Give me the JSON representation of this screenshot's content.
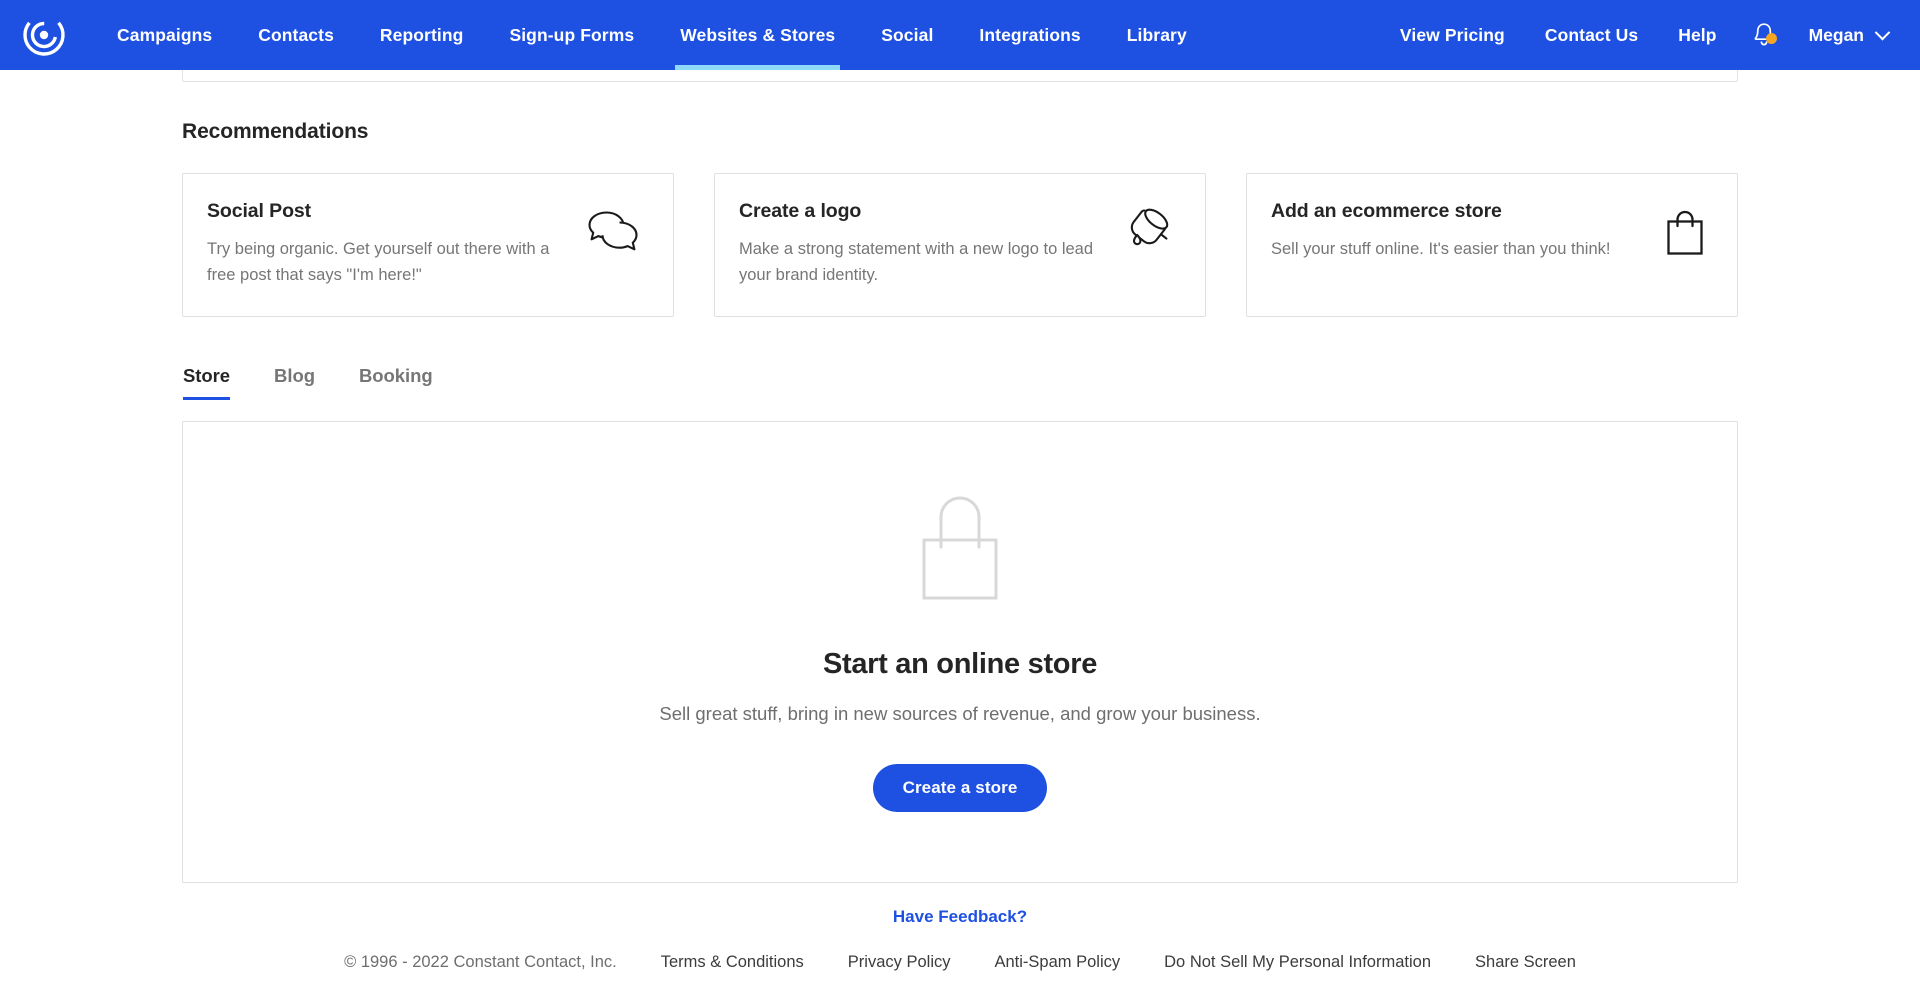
{
  "topnav": {
    "logo_icon": "constant-contact-logo-icon",
    "left_items": [
      {
        "label": "Campaigns",
        "active": false
      },
      {
        "label": "Contacts",
        "active": false
      },
      {
        "label": "Reporting",
        "active": false
      },
      {
        "label": "Sign-up Forms",
        "active": false
      },
      {
        "label": "Websites & Stores",
        "active": true
      },
      {
        "label": "Social",
        "active": false
      },
      {
        "label": "Integrations",
        "active": false
      },
      {
        "label": "Library",
        "active": false
      }
    ],
    "right_items": [
      {
        "label": "View Pricing"
      },
      {
        "label": "Contact Us"
      },
      {
        "label": "Help"
      }
    ],
    "bell_icon": "notification-bell-icon",
    "bell_has_alert": true,
    "user_name": "Megan",
    "user_caret_icon": "chevron-down-icon",
    "accent_color": "#1E50E2",
    "active_underline_color": "#8ED8F8",
    "alert_dot_color": "#F5A623"
  },
  "recommendations": {
    "heading": "Recommendations",
    "cards": [
      {
        "title": "Social Post",
        "description": "Try being organic. Get yourself out there with a free post that says \"I'm here!\"",
        "icon": "speech-bubbles-icon"
      },
      {
        "title": "Create a logo",
        "description": "Make a strong statement with a new logo to lead your brand identity.",
        "icon": "paint-bucket-icon"
      },
      {
        "title": "Add an ecommerce store",
        "description": "Sell your stuff online. It's easier than you think!",
        "icon": "shopping-bag-icon"
      }
    ]
  },
  "tabs": [
    {
      "label": "Store",
      "active": true
    },
    {
      "label": "Blog",
      "active": false
    },
    {
      "label": "Booking",
      "active": false
    }
  ],
  "empty_state": {
    "icon": "shopping-bag-outline-icon",
    "title": "Start an online store",
    "subtitle": "Sell great stuff, bring in new sources of revenue, and grow your business.",
    "button_label": "Create a store"
  },
  "footer": {
    "feedback_label": "Have Feedback?",
    "copyright": "© 1996 - 2022 Constant Contact, Inc.",
    "links": [
      "Terms & Conditions",
      "Privacy Policy",
      "Anti-Spam Policy",
      "Do Not Sell My Personal Information",
      "Share Screen"
    ]
  }
}
